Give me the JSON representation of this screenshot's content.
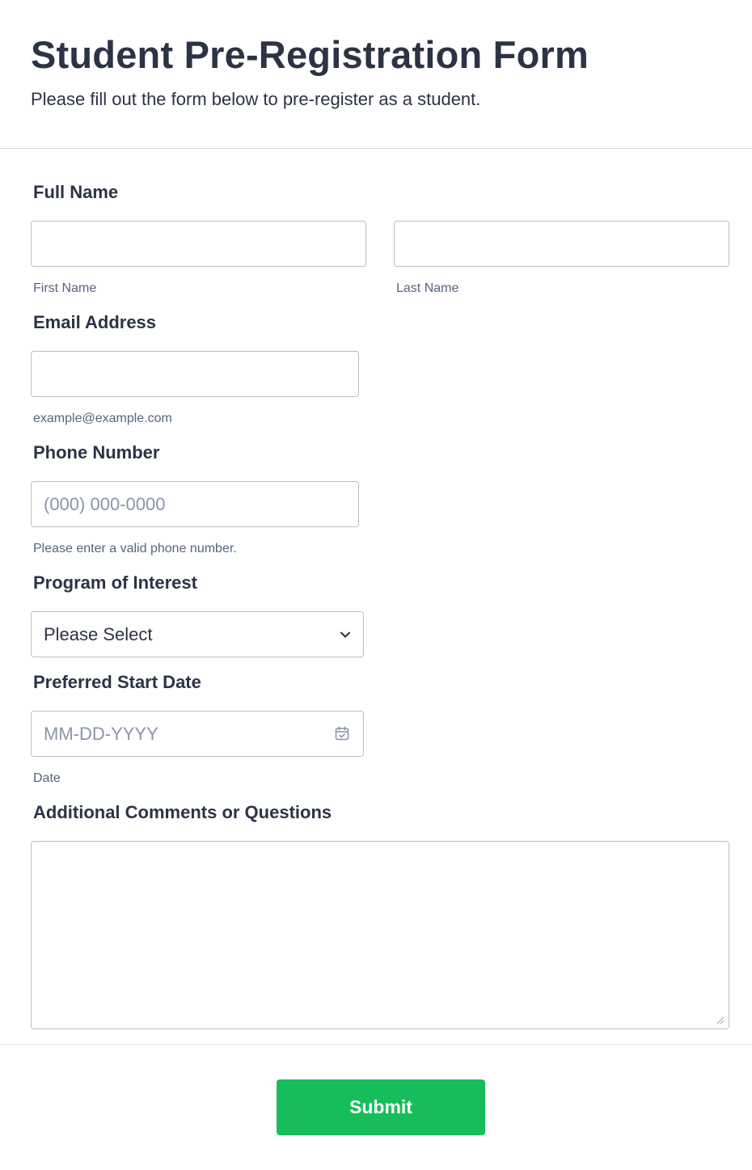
{
  "header": {
    "title": "Student Pre-Registration Form",
    "subtitle": "Please fill out the form below to pre-register as a student."
  },
  "fields": {
    "full_name": {
      "label": "Full Name",
      "first_value": "",
      "first_sublabel": "First Name",
      "last_value": "",
      "last_sublabel": "Last Name"
    },
    "email": {
      "label": "Email Address",
      "value": "",
      "sublabel": "example@example.com"
    },
    "phone": {
      "label": "Phone Number",
      "placeholder": "(000) 000-0000",
      "sublabel": "Please enter a valid phone number."
    },
    "program": {
      "label": "Program of Interest",
      "selected": "Please Select",
      "icon": "chevron-down-icon"
    },
    "start_date": {
      "label": "Preferred Start Date",
      "placeholder": "MM-DD-YYYY",
      "sublabel": "Date",
      "icon": "calendar-icon"
    },
    "comments": {
      "label": "Additional Comments or Questions",
      "value": ""
    }
  },
  "submit": {
    "label": "Submit",
    "color": "#18bd5b"
  },
  "colors": {
    "text": "#2c3345",
    "sublabel": "#57647e",
    "placeholder": "#8a94aa",
    "border": "#b8bdc9"
  }
}
